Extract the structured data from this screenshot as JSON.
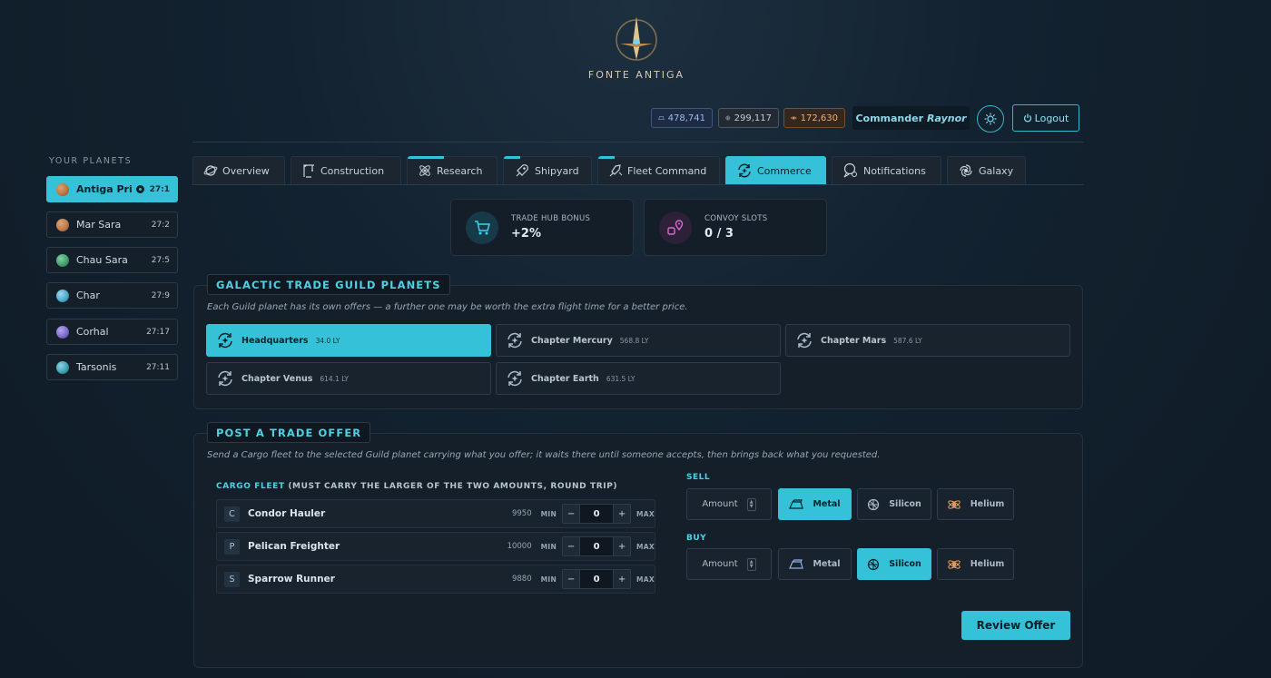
{
  "logo": {
    "text": "FONTE ANTIGA"
  },
  "resources": {
    "metal": "478,741",
    "silicon": "299,117",
    "helium": "172,630"
  },
  "commander": {
    "prefix": "Commander",
    "name": "Raynor"
  },
  "logout_label": "Logout",
  "sidebar": {
    "title": "YOUR PLANETS",
    "planets": [
      {
        "name": "Antiga Pri...",
        "coord": "27:1",
        "color": "#b8733e"
      },
      {
        "name": "Mar Sara",
        "coord": "27:2",
        "color": "#b87a4a"
      },
      {
        "name": "Chau Sara",
        "coord": "27:5",
        "color": "#3f9a6e"
      },
      {
        "name": "Char",
        "coord": "27:9",
        "color": "#4aa6c4"
      },
      {
        "name": "Corhal",
        "coord": "27:17",
        "color": "#7a68c8"
      },
      {
        "name": "Tarsonis",
        "coord": "27:11",
        "color": "#3c9cb0"
      }
    ]
  },
  "tabs": [
    {
      "label": "Overview",
      "icon": "planet-icon"
    },
    {
      "label": "Construction",
      "icon": "crane-icon"
    },
    {
      "label": "Research",
      "icon": "atom-icon"
    },
    {
      "label": "Shipyard",
      "icon": "rocket-icon"
    },
    {
      "label": "Fleet Command",
      "icon": "fleet-icon"
    },
    {
      "label": "Commerce",
      "icon": "exchange-icon"
    },
    {
      "label": "Notifications",
      "icon": "notification-icon"
    },
    {
      "label": "Galaxy",
      "icon": "galaxy-icon"
    }
  ],
  "stats": {
    "trade_hub": {
      "label": "TRADE HUB BONUS",
      "value": "+2%"
    },
    "convoy": {
      "label": "CONVOY SLOTS",
      "value": "0 / 3"
    }
  },
  "guild": {
    "title": "GALACTIC TRADE GUILD PLANETS",
    "desc": "Each Guild planet has its own offers — a further one may be worth the extra flight time for a better price.",
    "planets": [
      {
        "name": "Headquarters",
        "dist": "34.0 LY"
      },
      {
        "name": "Chapter Mercury",
        "dist": "568.8 LY"
      },
      {
        "name": "Chapter Mars",
        "dist": "587.6 LY"
      },
      {
        "name": "Chapter Venus",
        "dist": "614.1 LY"
      },
      {
        "name": "Chapter Earth",
        "dist": "631.5 LY"
      }
    ]
  },
  "offer": {
    "title": "POST A TRADE OFFER",
    "desc": "Send a Cargo fleet to the selected Guild planet carrying what you offer; it waits there until someone accepts, then brings back what you requested.",
    "fleet_label": "CARGO FLEET",
    "fleet_note": "(MUST CARRY THE LARGER OF THE TWO AMOUNTS, ROUND TRIP)",
    "min_label": "MIN",
    "max_label": "MAX",
    "ships": [
      {
        "letter": "C",
        "name": "Condor Hauler",
        "available": "9950",
        "qty": "0"
      },
      {
        "letter": "P",
        "name": "Pelican Freighter",
        "available": "10000",
        "qty": "0"
      },
      {
        "letter": "S",
        "name": "Sparrow Runner",
        "available": "9880",
        "qty": "0"
      }
    ],
    "sell_label": "SELL",
    "buy_label": "BUY",
    "amount_placeholder": "Amount",
    "resource_options": [
      "Metal",
      "Silicon",
      "Helium"
    ],
    "sell_selected": "Metal",
    "buy_selected": "Silicon",
    "review_label": "Review Offer"
  }
}
